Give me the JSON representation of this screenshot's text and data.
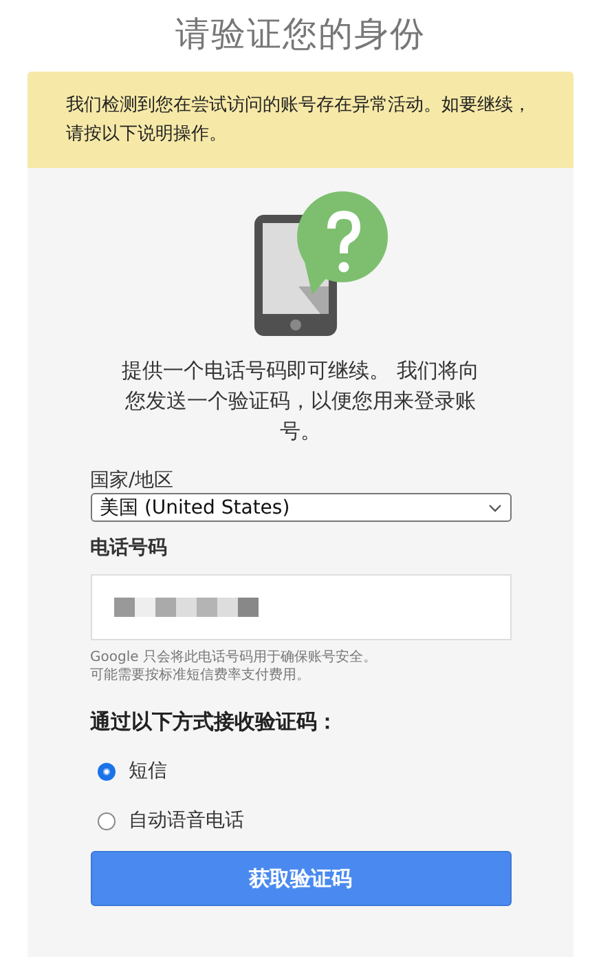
{
  "title": "请验证您的身份",
  "notice": "我们检测到您在尝试访问的账号存在异常活动。如要继续，请按以下说明操作。",
  "intro": "提供一个电话号码即可继续。 我们将向您发送一个验证码，以便您用来登录账号。",
  "country": {
    "label": "国家/地区",
    "value": "美国 (United States)"
  },
  "phone": {
    "label": "电话号码",
    "hint_lines": [
      "Google 只会将此电话号码用于确保账号安全。",
      "可能需要按标准短信费率支付费用。"
    ]
  },
  "method": {
    "heading": "通过以下方式接收验证码：",
    "options": [
      {
        "label": "短信",
        "selected": true
      },
      {
        "label": "自动语音电话",
        "selected": false
      }
    ]
  },
  "submit": "获取验证码"
}
